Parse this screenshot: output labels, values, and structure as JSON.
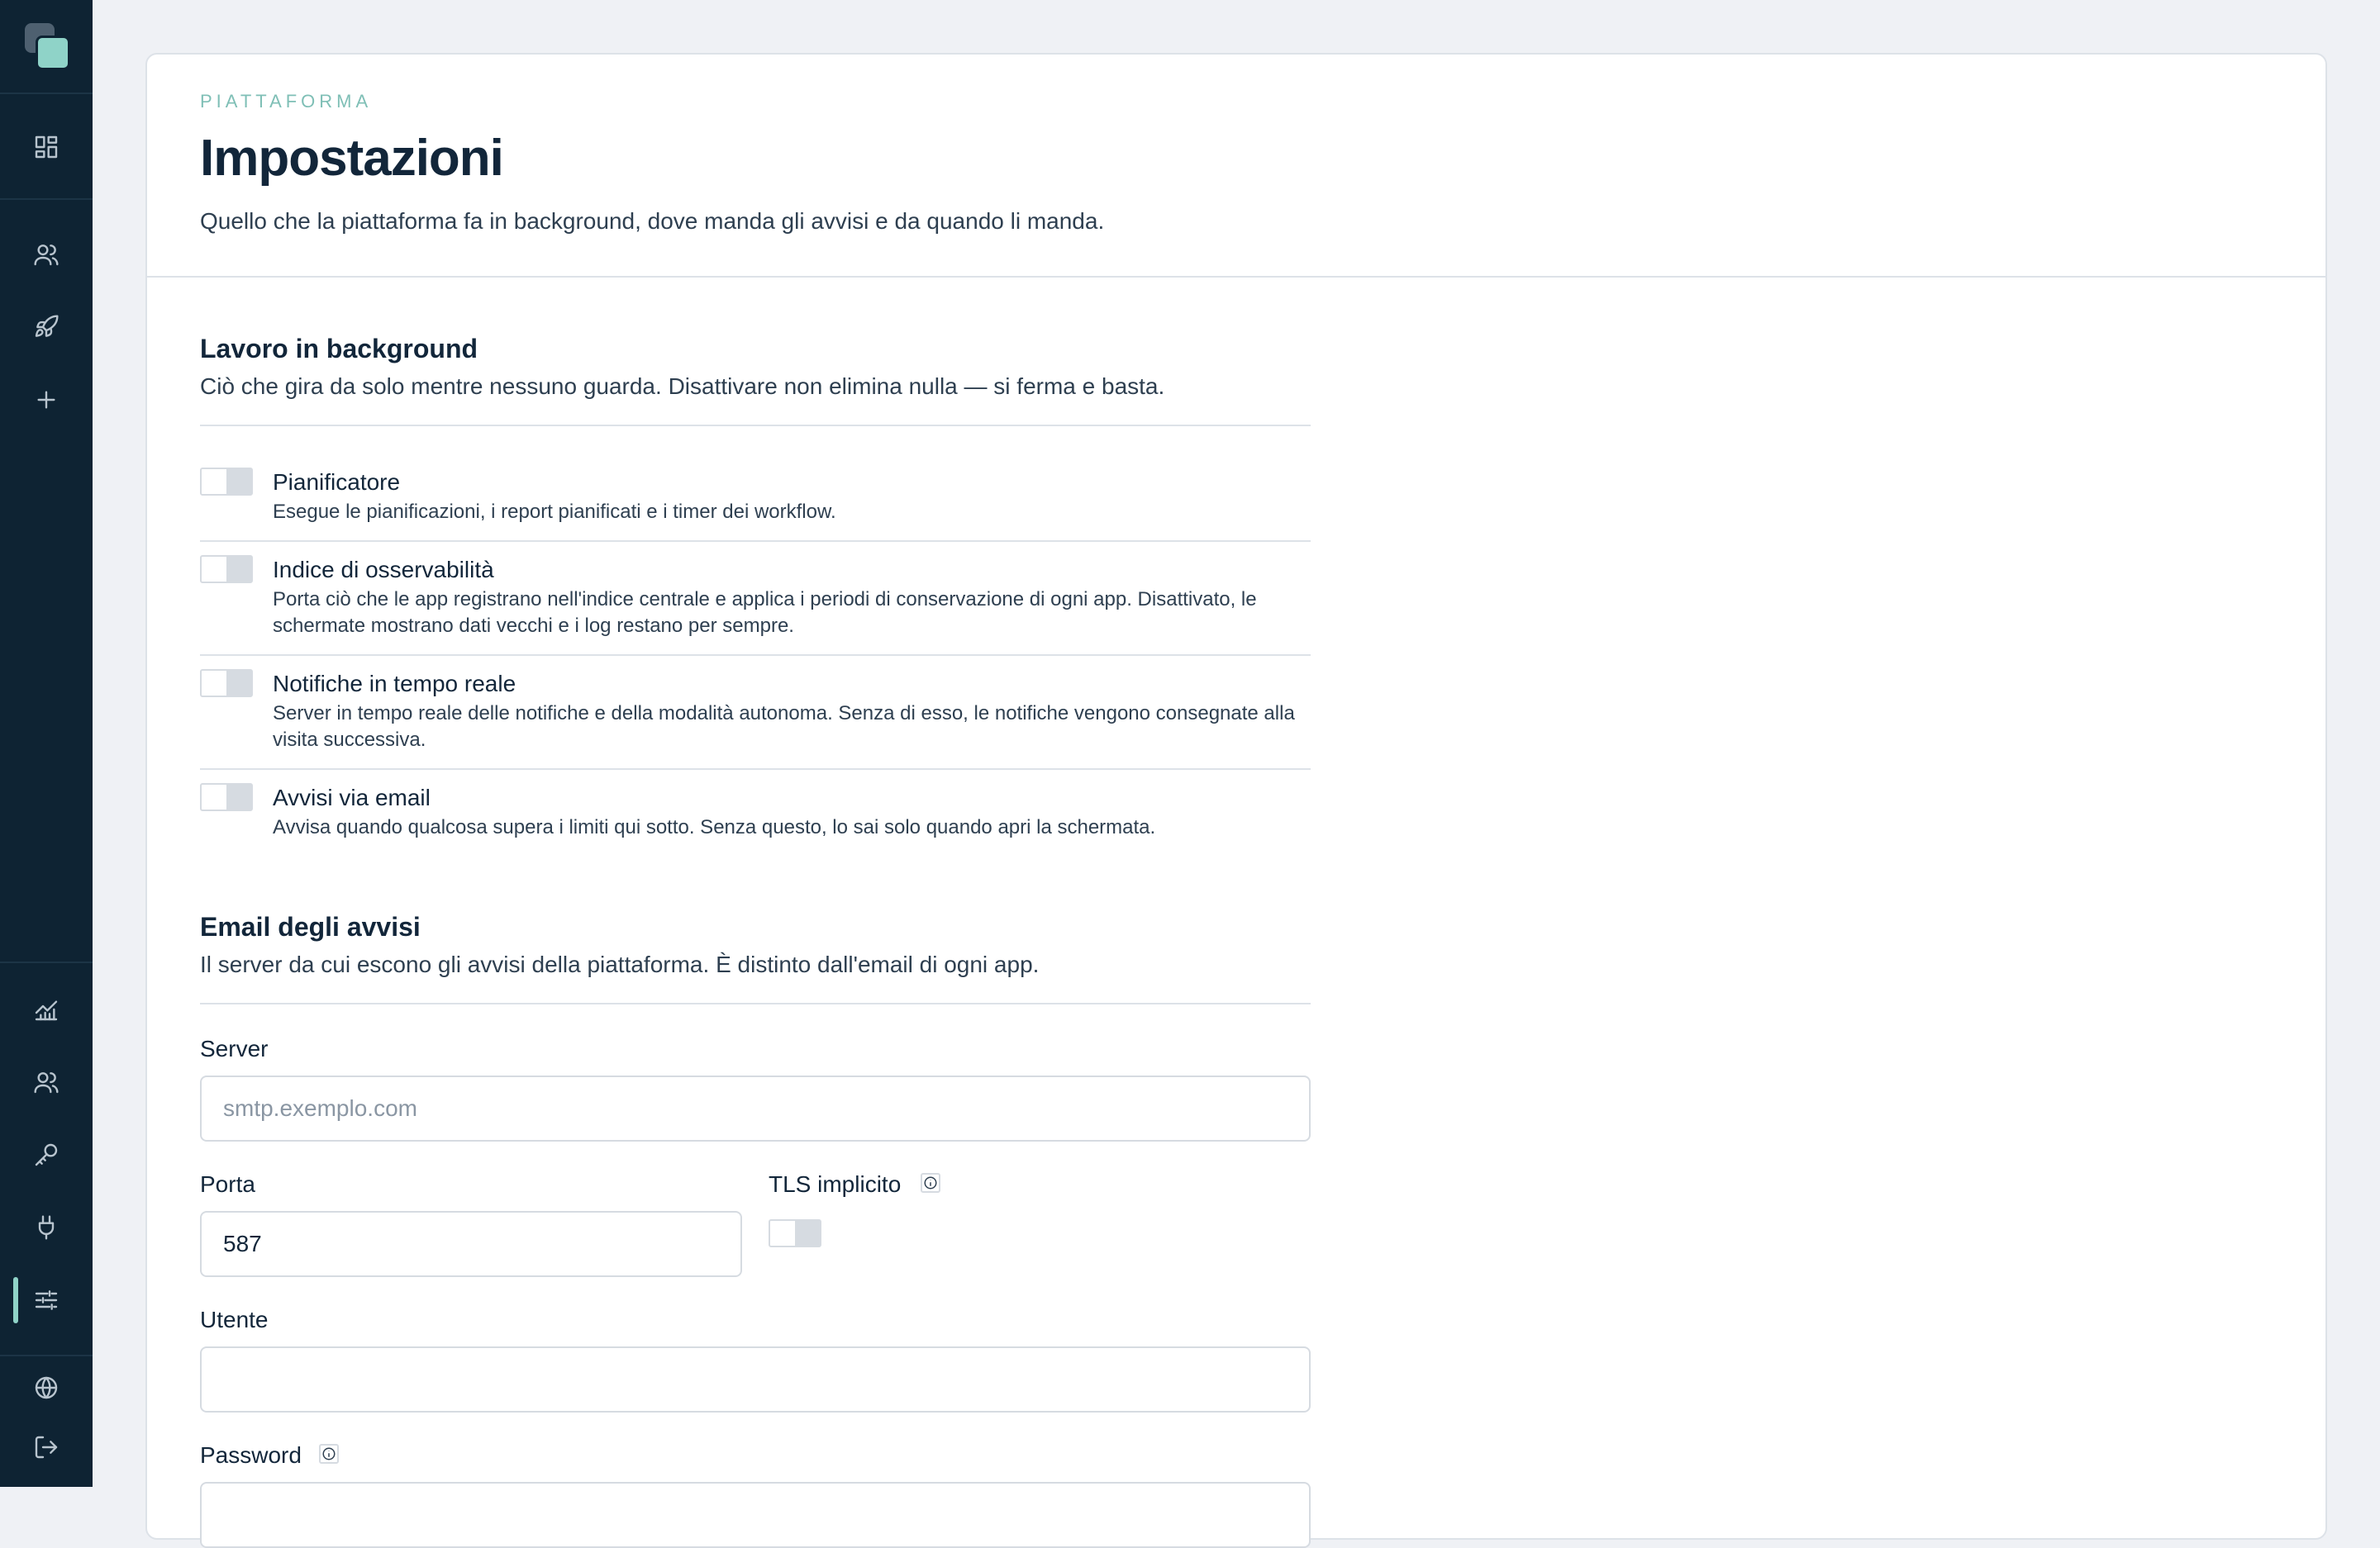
{
  "sidebar": {
    "icons": [
      "dashboard-icon",
      "users-icon",
      "rocket-icon",
      "plus-icon",
      "chart-icon",
      "team-icon",
      "key-icon",
      "plug-icon",
      "sliders-icon",
      "globe-icon",
      "logout-icon"
    ],
    "active": "sliders-icon",
    "accent_color": "#8fd3c8"
  },
  "header": {
    "kicker": "PIATTAFORMA",
    "title": "Impostazioni",
    "subtitle": "Quello che la piattaforma fa in background, dove manda gli avvisi e da quando li manda."
  },
  "background": {
    "title": "Lavoro in background",
    "description": "Ciò che gira da solo mentre nessuno guarda. Disattivare non elimina nulla — si ferma e basta.",
    "options": [
      {
        "title": "Pianificatore",
        "description": "Esegue le pianificazioni, i report pianificati e i timer dei workflow."
      },
      {
        "title": "Indice di osservabilità",
        "description": "Porta ciò che le app registrano nell'indice centrale e applica i periodi di conservazione di ogni app. Disattivato, le schermate mostrano dati vecchi e i log restano per sempre."
      },
      {
        "title": "Notifiche in tempo reale",
        "description": "Server in tempo reale delle notifiche e della modalità autonoma. Senza di esso, le notifiche vengono consegnate alla visita successiva."
      },
      {
        "title": "Avvisi via email",
        "description": "Avvisa quando qualcosa supera i limiti qui sotto. Senza questo, lo sai solo quando apri la schermata."
      }
    ]
  },
  "email": {
    "title": "Email degli avvisi",
    "description": "Il server da cui escono gli avvisi della piattaforma. È distinto dall'email di ogni app.",
    "server_label": "Server",
    "server_placeholder": "smtp.exemplo.com",
    "server_value": "",
    "port_label": "Porta",
    "port_value": "587",
    "tls_label": "TLS implicito",
    "user_label": "Utente",
    "user_value": "",
    "password_label": "Password"
  }
}
